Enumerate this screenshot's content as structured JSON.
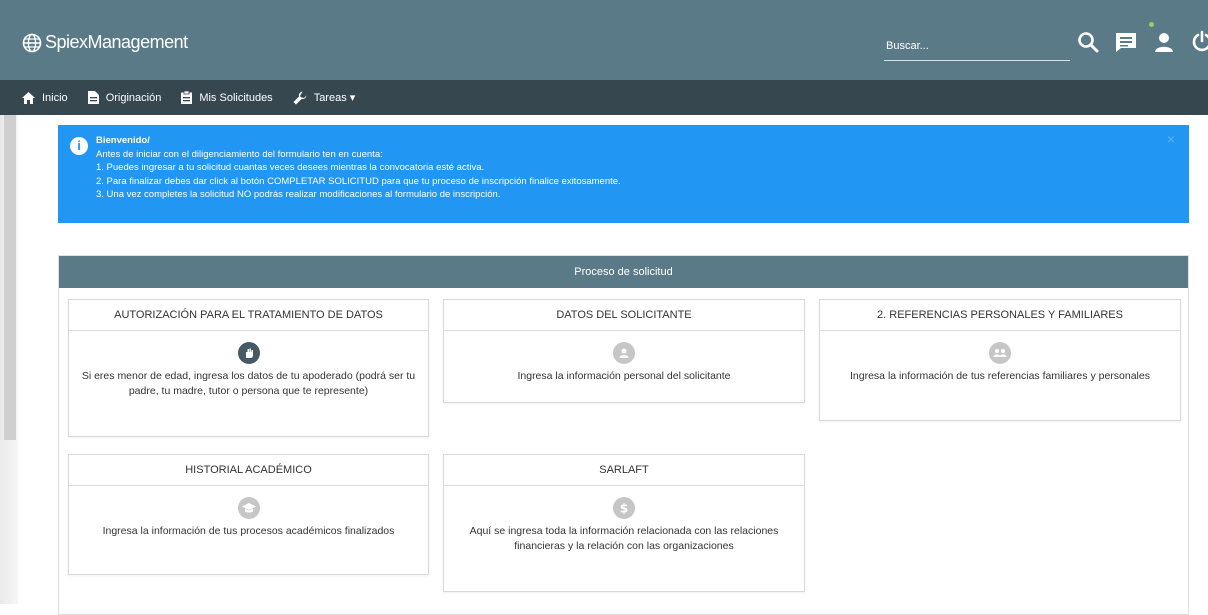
{
  "app": {
    "title": "SpiexManagement"
  },
  "search": {
    "placeholder": "Buscar..."
  },
  "topbar_icons": [
    "search-icon",
    "chat-icon",
    "user-icon",
    "power-icon"
  ],
  "nav": {
    "items": [
      {
        "label": "Inicio",
        "icon": "home-icon"
      },
      {
        "label": "Originación",
        "icon": "document-icon"
      },
      {
        "label": "Mis Solicitudes",
        "icon": "clipboard-icon"
      },
      {
        "label": "Tareas ▾",
        "icon": "wrench-icon"
      }
    ]
  },
  "alert": {
    "title": "Bienvenido/",
    "lines": [
      "Antes de iniciar con el diligenciamiento del formulario ten en cuenta:",
      "1. Puedes ingresar a tu solicitud cuantas veces desees mientras la convocatoria esté activa.",
      "2. Para finalizar debes dar click al botón COMPLETAR SOLICITUD para que tu proceso de inscripción finalice exitosamente.",
      "3. Una vez completes la solicitud NO podrás realizar modificaciones al formulario de inscripción."
    ],
    "close": "×",
    "color": "#2196f3"
  },
  "process": {
    "header": "Proceso de solicitud",
    "cards": [
      {
        "title": "AUTORIZACIÓN PARA EL TRATAMIENTO DE DATOS",
        "desc": "Si eres menor de edad, ingresa los datos de tu apoderado (podrá ser tu padre, tu madre, tutor o persona que te represente)",
        "icon": "hand-icon",
        "status_color": "#455a64"
      },
      {
        "title": "DATOS DEL SOLICITANTE",
        "desc": "Ingresa la información personal del solicitante",
        "icon": "person-icon",
        "status_color": "#c6c6c6"
      },
      {
        "title": "2. REFERENCIAS PERSONALES Y FAMILIARES",
        "desc": "Ingresa la información de tus referencias familiares y personales",
        "icon": "group-icon",
        "status_color": "#c6c6c6"
      },
      {
        "title": "HISTORIAL ACADÉMICO",
        "desc": "Ingresa la información de tus procesos académicos finalizados",
        "icon": "graduation-cap-icon",
        "status_color": "#c6c6c6"
      },
      {
        "title": "SARLAFT",
        "desc": "Aquí se ingresa toda la información relacionada con las relaciones financieras y la relación con las organizaciones",
        "icon": "dollar-icon",
        "status_color": "#c6c6c6"
      }
    ]
  },
  "colors": {
    "topbar": "#5b7a88",
    "navbar": "#37474f",
    "panel_header": "#5b7a88"
  }
}
